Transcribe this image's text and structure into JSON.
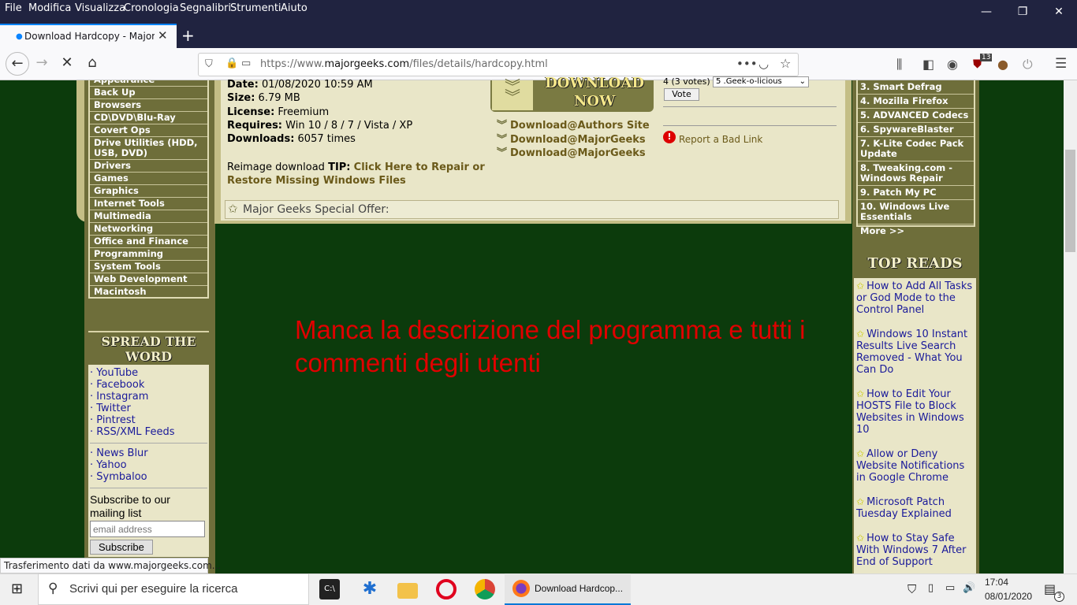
{
  "menu": [
    "File",
    "Modifica",
    "Visualizza",
    "Cronologia",
    "Segnalibri",
    "Strumenti",
    "Aiuto"
  ],
  "window_buttons": {
    "minimize": "—",
    "restore": "❐",
    "close": "✕"
  },
  "tab": {
    "title": "Download Hardcopy - MajorGe",
    "close": "✕"
  },
  "newtab": "+",
  "nav": {
    "back": "←",
    "forward": "→",
    "stop": "✕",
    "home": "⌂"
  },
  "url": {
    "prefix": "https://www.",
    "domain": "majorgeeks.com",
    "path": "/files/details/hardcopy.html"
  },
  "toolbar_badge": "13",
  "left_categories": [
    "Appearance",
    "Back Up",
    "Browsers",
    "CD\\DVD\\Blu-Ray",
    "Covert Ops",
    "Drive Utilities (HDD, USB, DVD)",
    "Drivers",
    "Games",
    "Graphics",
    "Internet Tools",
    "Multimedia",
    "Networking",
    "Office and Finance",
    "Programming",
    "System Tools",
    "Web Development",
    "Macintosh"
  ],
  "spread": {
    "title": "SPREAD THE WORD",
    "links1": [
      "YouTube",
      "Facebook",
      "Instagram",
      "Twitter",
      "Pintrest",
      "RSS/XML Feeds"
    ],
    "links2": [
      "News Blur",
      "Yahoo",
      "Symbaloo"
    ],
    "subscribe_text": "Subscribe to our mailing list",
    "email_placeholder": "email address",
    "subscribe_button": "Subscribe"
  },
  "details": {
    "date_label": "Date:",
    "date_value": "01/08/2020 10:59 AM",
    "size_label": "Size:",
    "size_value": "6.79 MB",
    "license_label": "License:",
    "license_value": "Freemium",
    "requires_label": "Requires:",
    "requires_value": "Win 10 / 8 / 7 / Vista / XP",
    "downloads_label": "Downloads:",
    "downloads_value": "6057 times",
    "tip_prefix": "Reimage download",
    "tip_label": "TIP:",
    "tip_link": "Click Here to Repair or Restore Missing Windows Files"
  },
  "download": {
    "button_text": "DOWNLOAD NOW",
    "links": [
      "Download@Authors Site",
      "Download@MajorGeeks",
      "Download@MajorGeeks"
    ]
  },
  "vote": {
    "votes_text": "4 (3 votes)",
    "select_value": "5 .Geek-o-licious",
    "button": "Vote",
    "bad_link": "Report a Bad Link"
  },
  "offer": "Major Geeks Special Offer:",
  "right_list": [
    "3. Smart Defrag",
    "4. Mozilla Firefox",
    "5. ADVANCED Codecs",
    "6. SpywareBlaster",
    "7. K-Lite Codec Pack Update",
    "8. Tweaking.com - Windows Repair",
    "9. Patch My PC",
    "10. Windows Live Essentials",
    "More >>"
  ],
  "top_reads": {
    "title": "TOP READS",
    "items": [
      "How to Add All Tasks or God Mode to the Control Panel",
      "Windows 10 Instant Results Live Search Removed - What You Can Do",
      "How to Edit Your HOSTS File to Block Websites in Windows 10",
      "Allow or Deny Website Notifications in Google Chrome",
      "Microsoft Patch Tuesday Explained",
      "How to Stay Safe With Windows 7 After End of Support"
    ]
  },
  "annotation": "Manca la descrizione del programma e tutti i commenti degli utenti",
  "status": "Trasferimento dati da www.majorgeeks.com...",
  "taskbar": {
    "search_placeholder": "Scrivi qui per eseguire la ricerca",
    "firefox_item": "Download Hardcop...",
    "time": "17:04",
    "date": "08/01/2020",
    "notifications": "3"
  }
}
